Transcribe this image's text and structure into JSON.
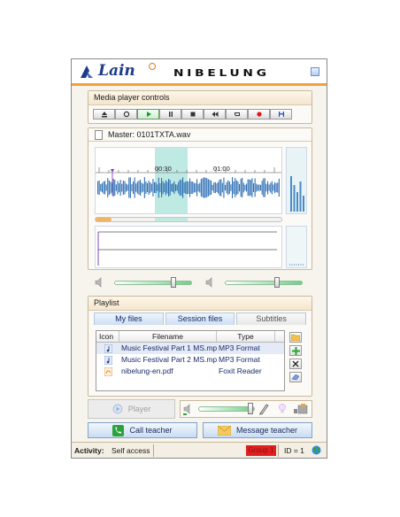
{
  "header": {
    "logo_text": "Lain",
    "brand_text": "NIBELUNG"
  },
  "media_controls": {
    "title": "Media player controls",
    "buttons": [
      "eject-icon",
      "stop-circle-icon",
      "play-icon",
      "pause-icon",
      "stop-icon",
      "rewind-icon",
      "loop-icon",
      "record-icon",
      "save-icon"
    ]
  },
  "master": {
    "label": "Master: 0101TXTA.wav",
    "timeline_marks": [
      "00:30",
      "01:00"
    ]
  },
  "volume": {
    "left_level": 0.78,
    "right_level": 0.68
  },
  "playlist": {
    "title": "Playlist",
    "tabs": [
      "My files",
      "Session files",
      "Subtitles"
    ],
    "active_tab": "My files",
    "columns": [
      "Icon",
      "Filename",
      "Type"
    ],
    "files": [
      {
        "icon": "music-note-icon",
        "name": "Music Festival Part 1 MS.mp",
        "type": "MP3 Format"
      },
      {
        "icon": "music-note-icon",
        "name": "Music Festival Part 2 MS.mp",
        "type": "MP3 Format"
      },
      {
        "icon": "pdf-icon",
        "name": "nibelung-en.pdf",
        "type": "Foxit Reader"
      }
    ]
  },
  "player": {
    "label": "Player"
  },
  "recording": {
    "level": 0.85
  },
  "actions": {
    "call_teacher": "Call teacher",
    "message_teacher": "Message teacher"
  },
  "status": {
    "activity_label": "Activity:",
    "activity_value": "Self access",
    "group": "Group 1",
    "id_text": "ID = 1"
  },
  "colors": {
    "accent_orange": "#f1a13a",
    "wave_blue": "#2f6fb3",
    "selection_teal": "#bfe9e3",
    "group_red": "#e02020"
  }
}
